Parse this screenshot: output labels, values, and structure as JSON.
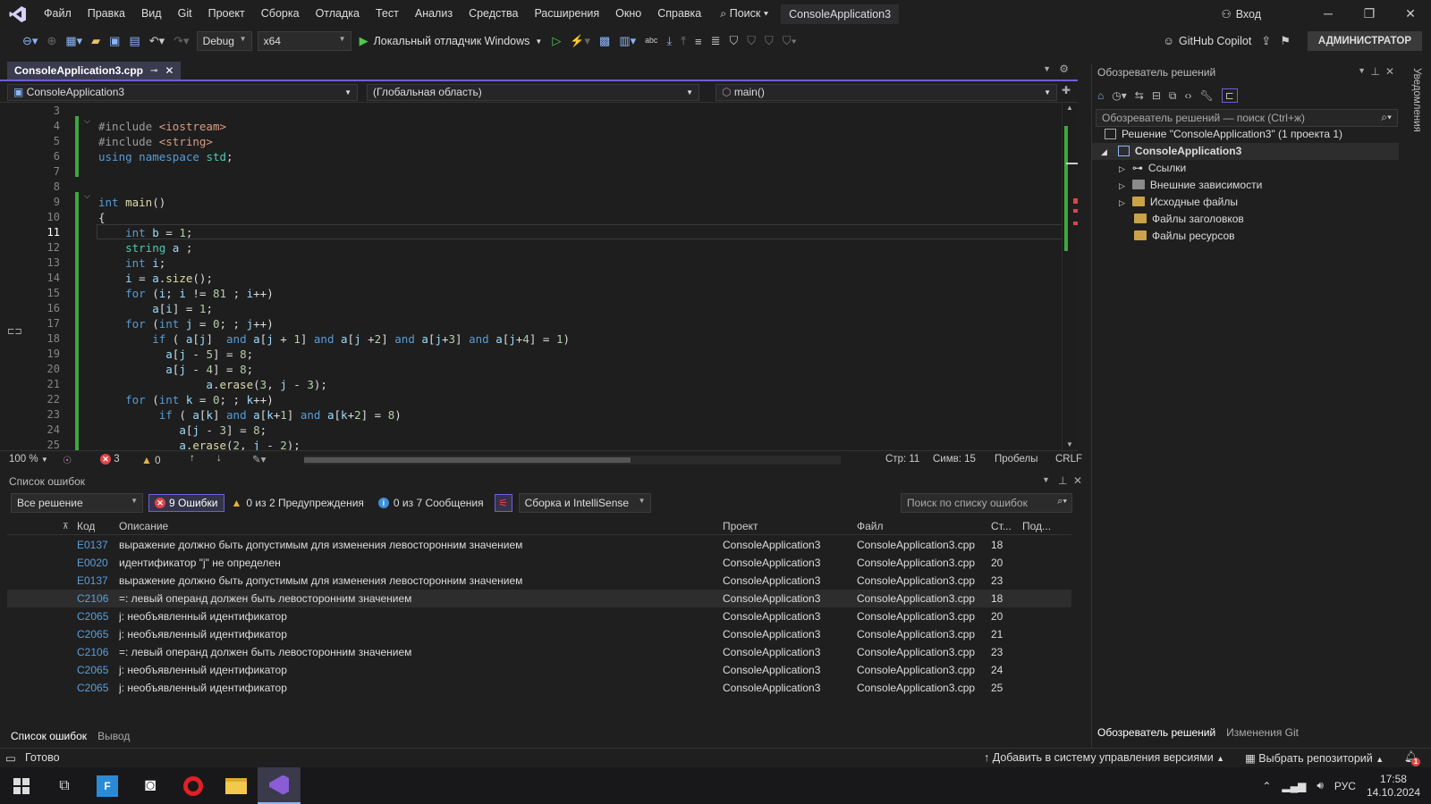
{
  "menu": {
    "items": [
      "Файл",
      "Правка",
      "Вид",
      "Git",
      "Проект",
      "Сборка",
      "Отладка",
      "Тест",
      "Анализ",
      "Средства",
      "Расширения",
      "Окно",
      "Справка"
    ],
    "search": "Поиск",
    "title": "ConsoleApplication3",
    "login": "Вход"
  },
  "toolbar": {
    "config": "Debug",
    "platform": "x64",
    "run": "Локальный отладчик Windows",
    "copilot": "GitHub Copilot",
    "admin": "АДМИНИСТРАТОР"
  },
  "editor": {
    "tab": "ConsoleApplication3.cpp",
    "nav_project": "ConsoleApplication3",
    "nav_scope": "(Глобальная область)",
    "nav_func": "main()",
    "zoom": "100 %",
    "errors": "3",
    "warnings": "0",
    "line": "Стр: 11",
    "col": "Симв: 15",
    "spaces": "Пробелы",
    "eol": "CRLF",
    "line_numbers": [
      "3",
      "4",
      "5",
      "6",
      "7",
      "8",
      "9",
      "10",
      "11",
      "12",
      "13",
      "14",
      "15",
      "16",
      "17",
      "18",
      "19",
      "20",
      "21",
      "22",
      "23",
      "24",
      "25"
    ],
    "code": [
      "",
      "#include <iostream>",
      "#include <string>",
      "using namespace std;",
      "",
      "",
      "int main()",
      "{",
      "    int b = 1;",
      "    string a ;",
      "    int i;",
      "    i = a.size();",
      "    for (i; i != 81 ; i++)",
      "        a[i] = 1;",
      "    for (int j = 0; ; j++)",
      "        if ( a[j]  and a[j + 1] and a[j +2] and a[j+3] and a[j+4] = 1)",
      "          a[j - 5] = 8;",
      "          a[j - 4] = 8;",
      "                a.erase(3, j - 3);",
      "    for (int k = 0; ; k++)",
      "         if ( a[k] and a[k+1] and a[k+2] = 8)",
      "            a[j - 3] = 8;",
      "            a.erase(2, j - 2);"
    ]
  },
  "errors": {
    "title": "Список ошибок",
    "scope": "Все решение",
    "errors_btn": "9 Ошибки",
    "warnings_btn": "0 из 2 Предупреждения",
    "messages_btn": "0 из 7 Сообщения",
    "build_filter": "Сборка и IntelliSense",
    "search": "Поиск по списку ошибок",
    "headers": {
      "code": "Код",
      "desc": "Описание",
      "project": "Проект",
      "file": "Файл",
      "line": "Ст...",
      "sup": "Под..."
    },
    "rows": [
      {
        "type": "intellisense",
        "code": "E0137",
        "desc": "выражение должно быть допустимым для изменения левосторонним значением",
        "project": "ConsoleApplication3",
        "file": "ConsoleApplication3.cpp",
        "line": "18"
      },
      {
        "type": "intellisense",
        "code": "E0020",
        "desc": "идентификатор \"j\" не определен",
        "project": "ConsoleApplication3",
        "file": "ConsoleApplication3.cpp",
        "line": "20"
      },
      {
        "type": "intellisense",
        "code": "E0137",
        "desc": "выражение должно быть допустимым для изменения левосторонним значением",
        "project": "ConsoleApplication3",
        "file": "ConsoleApplication3.cpp",
        "line": "23"
      },
      {
        "type": "error",
        "code": "C2106",
        "desc": "=: левый операнд должен быть левосторонним значением",
        "project": "ConsoleApplication3",
        "file": "ConsoleApplication3.cpp",
        "line": "18"
      },
      {
        "type": "error",
        "code": "C2065",
        "desc": "j: необъявленный идентификатор",
        "project": "ConsoleApplication3",
        "file": "ConsoleApplication3.cpp",
        "line": "20"
      },
      {
        "type": "error",
        "code": "C2065",
        "desc": "j: необъявленный идентификатор",
        "project": "ConsoleApplication3",
        "file": "ConsoleApplication3.cpp",
        "line": "21"
      },
      {
        "type": "error",
        "code": "C2106",
        "desc": "=: левый операнд должен быть левосторонним значением",
        "project": "ConsoleApplication3",
        "file": "ConsoleApplication3.cpp",
        "line": "23"
      },
      {
        "type": "error",
        "code": "C2065",
        "desc": "j: необъявленный идентификатор",
        "project": "ConsoleApplication3",
        "file": "ConsoleApplication3.cpp",
        "line": "24"
      },
      {
        "type": "error",
        "code": "C2065",
        "desc": "j: необъявленный идентификатор",
        "project": "ConsoleApplication3",
        "file": "ConsoleApplication3.cpp",
        "line": "25"
      }
    ],
    "tab_errors": "Список ошибок",
    "tab_output": "Вывод"
  },
  "solution": {
    "title": "Обозреватель решений",
    "search": "Обозреватель решений — поиск (Ctrl+ж)",
    "root": "Решение \"ConsoleApplication3\" (1 проекта 1)",
    "project": "ConsoleApplication3",
    "nodes": [
      "Ссылки",
      "Внешние зависимости",
      "Исходные файлы",
      "Файлы заголовков",
      "Файлы ресурсов"
    ],
    "tab_solution": "Обозреватель решений",
    "tab_git": "Изменения Git"
  },
  "side": {
    "notifications": "Уведомления"
  },
  "status": {
    "ready": "Готово",
    "add_vcs": "Добавить в систему управления версиями",
    "repo": "Выбрать репозиторий",
    "notif_count": "1"
  },
  "taskbar": {
    "lang": "РУС",
    "time": "17:58",
    "date": "14.10.2024"
  },
  "colors": {
    "accent": "#6f5fd6",
    "error": "#e04444",
    "warning": "#e3b341",
    "info": "#3c8fd9",
    "change_bar": "#3ca83c"
  }
}
